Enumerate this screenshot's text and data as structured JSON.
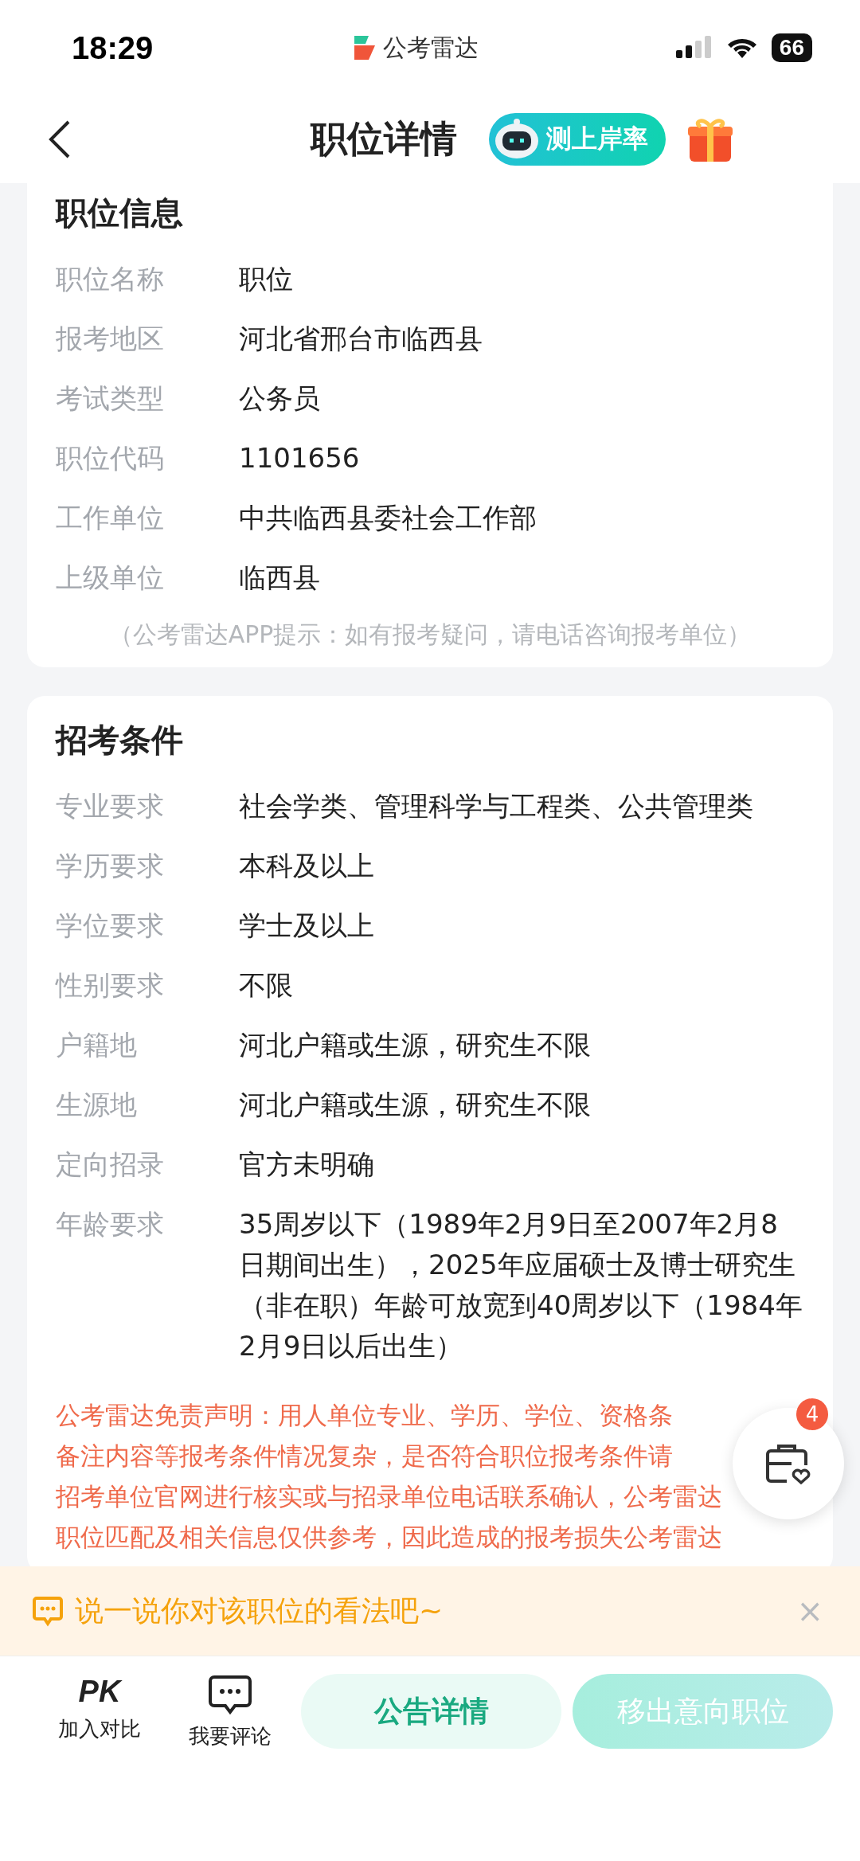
{
  "status_bar": {
    "time": "18:29",
    "app_name": "公考雷达",
    "battery": "66"
  },
  "nav": {
    "title": "职位详情",
    "rate_button": "测上岸率"
  },
  "position_info": {
    "title": "职位信息",
    "rows": [
      {
        "label": "职位名称",
        "value": "职位"
      },
      {
        "label": "报考地区",
        "value": "河北省邢台市临西县"
      },
      {
        "label": "考试类型",
        "value": "公务员"
      },
      {
        "label": "职位代码",
        "value": "1101656"
      },
      {
        "label": "工作单位",
        "value": "中共临西县委社会工作部"
      },
      {
        "label": "上级单位",
        "value": "临西县"
      }
    ],
    "tip": "（公考雷达APP提示：如有报考疑问，请电话咨询报考单位）"
  },
  "requirements": {
    "title": "招考条件",
    "rows": [
      {
        "label": "专业要求",
        "value": "社会学类、管理科学与工程类、公共管理类"
      },
      {
        "label": "学历要求",
        "value": "本科及以上"
      },
      {
        "label": "学位要求",
        "value": "学士及以上"
      },
      {
        "label": "性别要求",
        "value": "不限"
      },
      {
        "label": "户籍地",
        "value": "河北户籍或生源，研究生不限"
      },
      {
        "label": "生源地",
        "value": "河北户籍或生源，研究生不限"
      },
      {
        "label": "定向招录",
        "value": "官方未明确"
      },
      {
        "label": "年龄要求",
        "value": "35周岁以下（1989年2月9日至2007年2月8日期间出生），2025年应届硕士及博士研究生（非在职）年龄可放宽到40周岁以下（1984年2月9日以后出生）"
      }
    ],
    "disclaimer_lines": [
      "公考雷达免责声明：用人单位专业、学历、学位、资格条",
      "备注内容等报考条件情况复杂，是否符合职位报考条件请",
      "招考单位官网进行核实或与招录单位电话联系确认，公考雷达",
      "职位匹配及相关信息仅供参考，因此造成的报考损失公考雷达"
    ]
  },
  "floating_button": {
    "badge": "4"
  },
  "comment_banner": {
    "text": "说一说你对该职位的看法吧~",
    "close": "×"
  },
  "bottom_bar": {
    "compare": {
      "icon_text": "PK",
      "label": "加入对比"
    },
    "comment": {
      "label": "我要评论"
    },
    "notice_button": "公告详情",
    "remove_button": "移出意向职位"
  }
}
